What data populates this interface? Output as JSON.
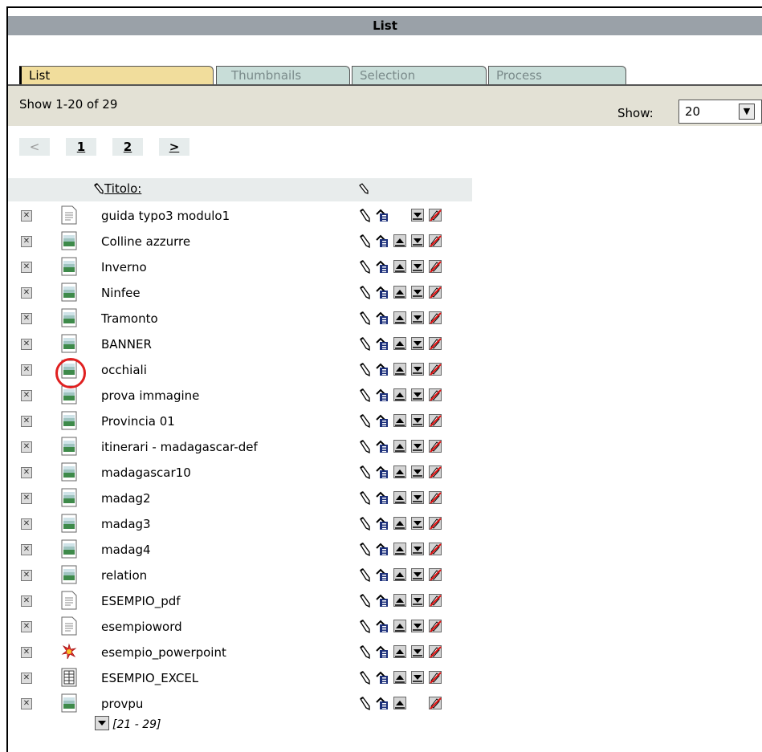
{
  "window": {
    "title": "List"
  },
  "tabs": [
    {
      "label": "List",
      "active": true
    },
    {
      "label": "Thumbnails",
      "active": false
    },
    {
      "label": "Selection",
      "active": false
    },
    {
      "label": "Process",
      "active": false
    }
  ],
  "status": {
    "range_text": "Show 1-20 of 29",
    "show_label": "Show:",
    "show_value": "20"
  },
  "pager": {
    "prev": "<",
    "pages": [
      "1",
      "2"
    ],
    "next": ">"
  },
  "list": {
    "title_header": "Titolo:",
    "rows": [
      {
        "name": "guida typo3 modulo1",
        "icon": "text-doc-icon",
        "move_up": false,
        "move_down": true
      },
      {
        "name": "Colline azzurre",
        "icon": "image-icon",
        "move_up": true,
        "move_down": true
      },
      {
        "name": "Inverno",
        "icon": "image-icon",
        "move_up": true,
        "move_down": true
      },
      {
        "name": "Ninfee",
        "icon": "image-icon",
        "move_up": true,
        "move_down": true
      },
      {
        "name": "Tramonto",
        "icon": "image-icon",
        "move_up": true,
        "move_down": true
      },
      {
        "name": "BANNER",
        "icon": "image-icon",
        "move_up": true,
        "move_down": true
      },
      {
        "name": "occhiali",
        "icon": "image-icon",
        "move_up": true,
        "move_down": true
      },
      {
        "name": "prova immagine",
        "icon": "image-icon",
        "move_up": true,
        "move_down": true
      },
      {
        "name": "Provincia 01",
        "icon": "image-icon",
        "move_up": true,
        "move_down": true
      },
      {
        "name": "itinerari - madagascar-def",
        "icon": "image-icon",
        "move_up": true,
        "move_down": true
      },
      {
        "name": "madagascar10",
        "icon": "image-icon",
        "move_up": true,
        "move_down": true
      },
      {
        "name": "madag2",
        "icon": "image-icon",
        "move_up": true,
        "move_down": true
      },
      {
        "name": "madag3",
        "icon": "image-icon",
        "move_up": true,
        "move_down": true
      },
      {
        "name": "madag4",
        "icon": "image-icon",
        "move_up": true,
        "move_down": true
      },
      {
        "name": "relation",
        "icon": "image-icon",
        "move_up": true,
        "move_down": true
      },
      {
        "name": "ESEMPIO_pdf",
        "icon": "text-doc-icon",
        "move_up": true,
        "move_down": true
      },
      {
        "name": "esempioword",
        "icon": "text-doc-icon",
        "move_up": true,
        "move_down": true
      },
      {
        "name": "esempio_powerpoint",
        "icon": "powerpoint-icon",
        "move_up": true,
        "move_down": true
      },
      {
        "name": "ESEMPIO_EXCEL",
        "icon": "spreadsheet-icon",
        "move_up": true,
        "move_down": true
      },
      {
        "name": "provpu",
        "icon": "image-icon",
        "move_up": true,
        "move_down": false
      }
    ],
    "more_label": "[21 - 29]"
  },
  "colors": {
    "titlebar": "#9aa1a8",
    "tab_active": "#f1dd9c",
    "tab_inactive": "#c8ddd8",
    "status_bar": "#e3e1d5",
    "highlight_circle": "#e02020"
  }
}
